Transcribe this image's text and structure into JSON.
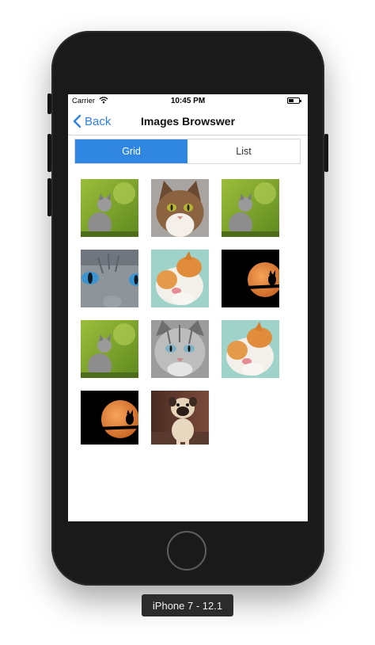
{
  "status_bar": {
    "carrier": "Carrier",
    "time": "10:45 PM",
    "wifi_icon": "wifi-icon",
    "battery_icon": "battery-icon"
  },
  "nav": {
    "back_label": "Back",
    "back_icon": "chevron-left-icon",
    "title": "Images Browswer"
  },
  "segmented_control": {
    "grid_label": "Grid",
    "list_label": "List",
    "selected": "Grid"
  },
  "images": [
    {
      "subject": "kitten-on-grass"
    },
    {
      "subject": "tabby-cat-face"
    },
    {
      "subject": "kitten-on-grass"
    },
    {
      "subject": "cat-blue-eyes-closeup"
    },
    {
      "subject": "orange-cat-licking-paw"
    },
    {
      "subject": "cat-silhouette-moon"
    },
    {
      "subject": "kitten-on-grass"
    },
    {
      "subject": "grey-tabby-cat-face"
    },
    {
      "subject": "orange-cat-licking-paw"
    },
    {
      "subject": "cat-silhouette-moon"
    },
    {
      "subject": "pug-puppy"
    }
  ],
  "device_label": "iPhone 7 - 12.1",
  "colors": {
    "accent": "#2f87e1",
    "link": "#2f7fe0",
    "device_body": "#1a1a1a"
  }
}
